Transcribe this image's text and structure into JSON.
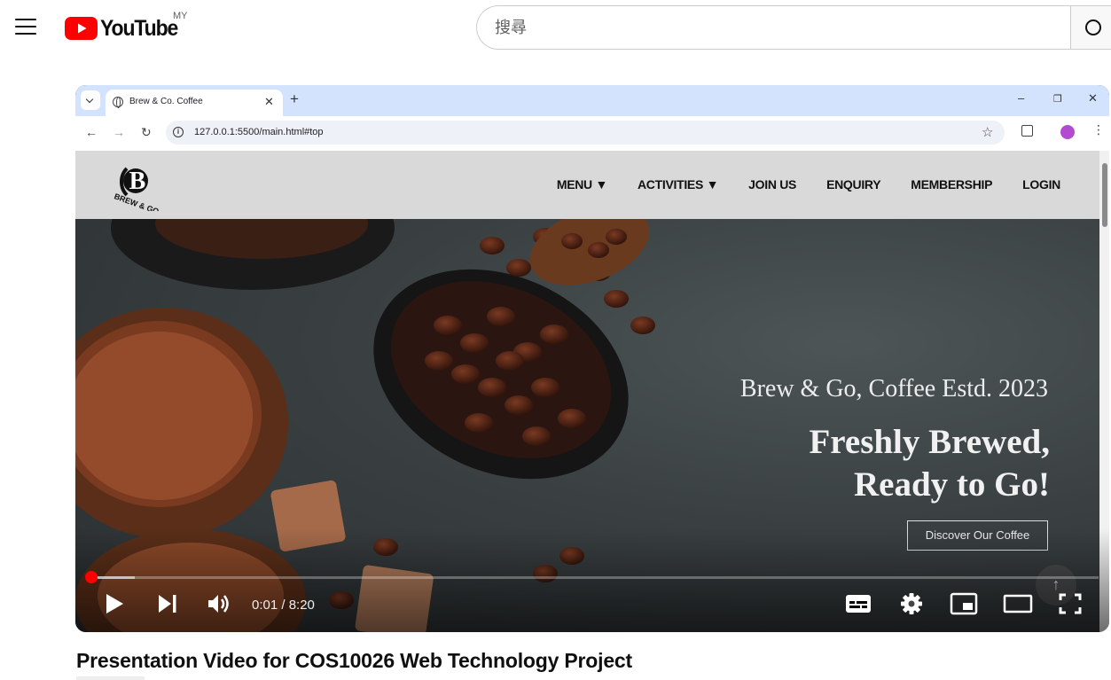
{
  "masthead": {
    "logo_text": "YouTube",
    "country_code": "MY",
    "search_placeholder": "搜尋",
    "icons": [
      "menu-icon",
      "youtube-play-icon",
      "search-icon"
    ],
    "brand_color": "#ff0000"
  },
  "browser": {
    "tab_title": "Brew & Co. Coffee",
    "url": "127.0.0.1:5500/main.html#top",
    "window_controls": [
      "–",
      "❐",
      "✕"
    ],
    "new_tab_label": "+",
    "tab_bar_color": "#d3e3fd"
  },
  "site": {
    "logo_text": "BREW & GO",
    "nav": [
      "MENU ▼",
      "ACTIVITIES ▼",
      "JOIN US",
      "ENQUIRY",
      "MEMBERSHIP",
      "LOGIN"
    ],
    "hero_estd": "Brew & Go, Coffee Estd. 2023",
    "hero_line1": "Freshly Brewed,",
    "hero_line2": "Ready to Go!",
    "hero_button": "Discover Our Coffee",
    "scroll_top_label": "↑"
  },
  "player": {
    "time_current": "0:01",
    "time_total": "8:20",
    "time_display": "0:01 / 8:20",
    "played_fraction": 0.002,
    "buffered_fraction": 0.048,
    "accent_color": "#ff0000",
    "controls": [
      "play-icon",
      "next-icon",
      "volume-icon",
      "subtitles-icon",
      "settings-icon",
      "miniplayer-icon",
      "theater-icon",
      "fullscreen-icon"
    ]
  },
  "video": {
    "title": "Presentation Video for COS10026 Web Technology Project"
  }
}
